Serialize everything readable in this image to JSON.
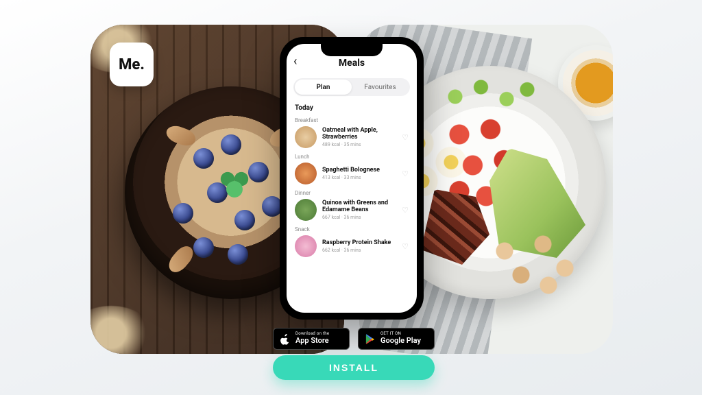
{
  "logo": {
    "text": "Me."
  },
  "phone": {
    "title": "Meals",
    "tabs": {
      "plan": "Plan",
      "favourites": "Favourites"
    },
    "today_label": "Today",
    "meals": [
      {
        "section": "Breakfast",
        "name": "Oatmeal with Apple, Strawberries",
        "kcal": "489 kcal",
        "time": "35 mins"
      },
      {
        "section": "Lunch",
        "name": "Spaghetti Bolognese",
        "kcal": "413 kcal",
        "time": "33 mins"
      },
      {
        "section": "Dinner",
        "name": "Quinoa with Greens and Edamame Beans",
        "kcal": "667 kcal",
        "time": "36 mins"
      },
      {
        "section": "Snack",
        "name": "Raspberry Protein Shake",
        "kcal": "662 kcal",
        "time": "36 mins"
      }
    ]
  },
  "store": {
    "apple_l1": "Download on the",
    "apple_l2": "App Store",
    "google_l1": "GET IT ON",
    "google_l2": "Google Play"
  },
  "cta": {
    "install": "INSTALL"
  }
}
